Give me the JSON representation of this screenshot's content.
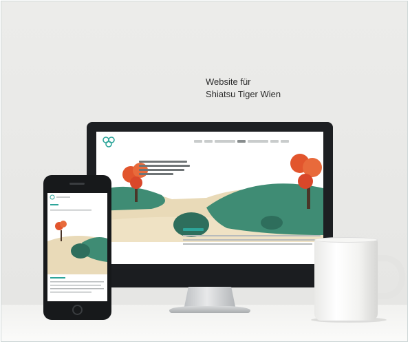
{
  "caption": {
    "line1": "Website für",
    "line2": "Shiatsu Tiger Wien"
  },
  "colors": {
    "accent_teal": "#2da59a",
    "tree_red": "#e2552d",
    "hill_green": "#3f8c74",
    "sand": "#e7d6b4"
  },
  "icons": {
    "logo": "shiatsu-tiger-logo-icon"
  }
}
